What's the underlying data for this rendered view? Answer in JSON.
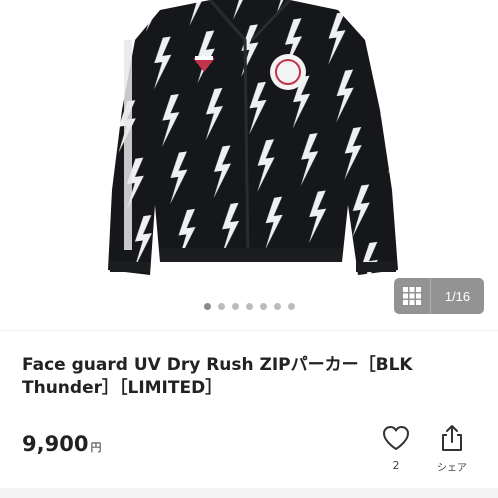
{
  "gallery": {
    "counter": "1/16",
    "dot_count": 7,
    "active_dot": 0,
    "icons": {
      "grid": "grid-icon"
    }
  },
  "product": {
    "title": "Face guard UV Dry Rush ZIPパーカー［BLK Thunder］［LIMITED］",
    "price": "9,900",
    "currency": "円"
  },
  "actions": {
    "like_count": "2",
    "share_label": "シェア",
    "icons": {
      "like": "heart-icon",
      "share": "share-icon"
    }
  }
}
